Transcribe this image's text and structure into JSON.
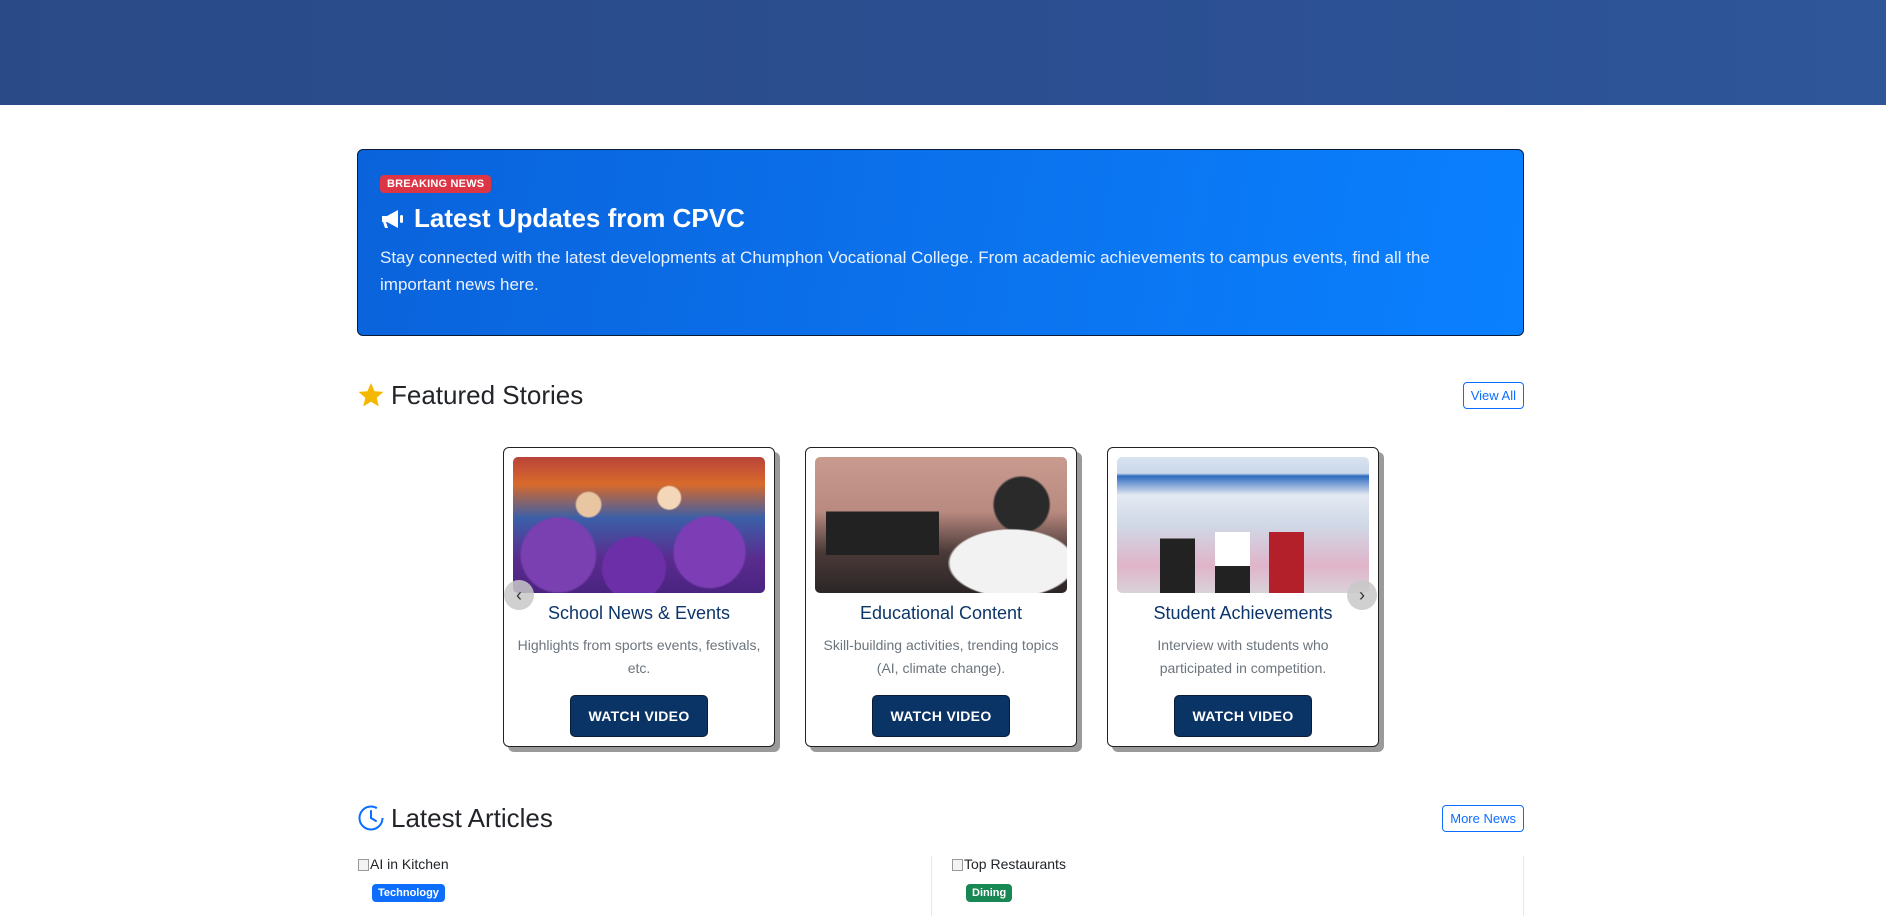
{
  "hero": {
    "badge": "BREAKING NEWS",
    "title": "Latest Updates from CPVC",
    "description": "Stay connected with the latest developments at Chumphon Vocational College. From academic achievements to campus events, find all the important news here.",
    "icon": "megaphone-icon"
  },
  "featured": {
    "title": "Featured Stories",
    "icon": "star-icon",
    "view_all_label": "View All",
    "cards": [
      {
        "title": "School News & Events",
        "text": "Highlights from sports events, festivals, etc.",
        "button": "WATCH VIDEO"
      },
      {
        "title": "Educational Content",
        "text": "Skill-building activities, trending topics (AI, climate change).",
        "button": "WATCH VIDEO"
      },
      {
        "title": "Student Achievements",
        "text": "Interview with students who participated in competition.",
        "button": "WATCH VIDEO"
      }
    ]
  },
  "latest": {
    "title": "Latest Articles",
    "icon": "clock-icon",
    "more_label": "More News",
    "articles": [
      {
        "img_alt": "AI in Kitchen",
        "tag": "Technology",
        "tag_color": "#0d6efd"
      },
      {
        "img_alt": "Top Restaurants",
        "tag": "Dining",
        "tag_color": "#198754"
      }
    ]
  },
  "colors": {
    "banner": "#2b4f92",
    "hero_blue": "#0b73ee",
    "breaking_red": "#dc3545",
    "navy_button": "#0a3366",
    "star_yellow": "#f5b800"
  }
}
